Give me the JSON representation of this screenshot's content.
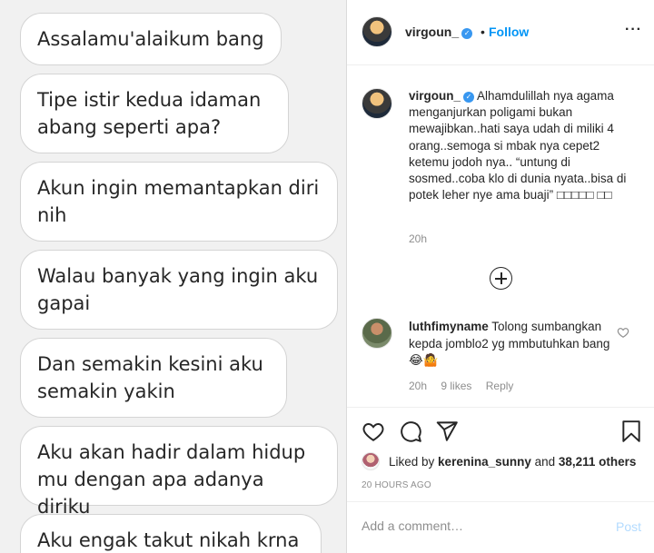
{
  "chat": {
    "messages": [
      "Assalamu'alaikum bang",
      "Tipe istir kedua  idaman abang seperti apa?",
      "Akun ingin memantapkan diri nih",
      "Walau banyak yang ingin aku gapai",
      "Dan semakin kesini aku semakin yakin",
      "Aku akan hadir dalam hidup mu dengan apa adanya diriku",
      "Aku engak takut nikah krna"
    ]
  },
  "post": {
    "header": {
      "username": "virgoun_",
      "dot": "•",
      "follow_label": "Follow",
      "more": "···"
    },
    "caption": {
      "username": "virgoun_",
      "text": "Alhamdulillah nya agama menganjurkan poligami bukan mewajibkan..hati saya udah di miliki 4 orang..semoga si mbak nya cepet2 ketemu jodoh nya.. “untung di sosmed..coba klo di dunia nyata..bisa di potek leher nye ama buaji” □□□□□ □□",
      "time": "20h"
    },
    "comment": {
      "username": "luthfimyname",
      "text": "Tolong sumbangkan kepda jomblo2 yg mmbutuhkan bang 😂🤷",
      "time": "20h",
      "likes": "9 likes",
      "reply": "Reply"
    },
    "likes": {
      "prefix": "Liked by ",
      "user": "kerenina_sunny",
      "middle": " and ",
      "count": "38,211 others"
    },
    "timestamp": "20 HOURS AGO",
    "add_comment": {
      "placeholder": "Add a comment…",
      "post_label": "Post"
    }
  },
  "colors": {
    "link": "#0095f6",
    "verified": "#3897f0",
    "muted": "#8e8e8e",
    "post_disabled": "#b3dbff"
  },
  "icons": [
    "verified-icon",
    "more-icon",
    "plus-circle-icon",
    "heart-icon",
    "comment-icon",
    "share-icon",
    "bookmark-icon"
  ]
}
